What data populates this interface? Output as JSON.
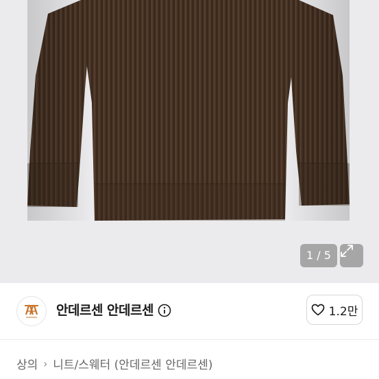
{
  "gallery": {
    "current_page": "1",
    "total_pages": "5",
    "counter_text": "1 / 5",
    "image_subject": "brown ribbed knit sweater",
    "bg_color": "#ebebed",
    "sweater_color": "#4a3526"
  },
  "shop": {
    "name": "안데르센 안데르센",
    "logo_icon": "andersen-logo-icon",
    "logo_color": "#c8742b",
    "info_icon": "info-icon"
  },
  "like": {
    "icon": "heart-icon",
    "count": "1.2만"
  },
  "breadcrumb": {
    "separator": "›",
    "items": [
      "상의",
      "니트/스웨터 (안데르센 안데르센)"
    ]
  }
}
